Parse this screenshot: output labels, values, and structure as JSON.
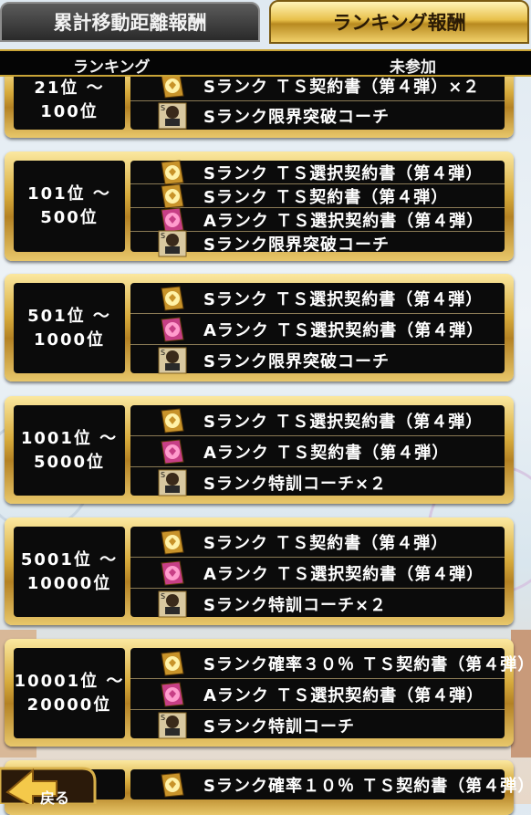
{
  "tabs": [
    {
      "label": "累計移動距離報酬",
      "active": false
    },
    {
      "label": "ランキング報酬",
      "active": true
    }
  ],
  "header": {
    "rank_label": "ランキング",
    "status": "未参加"
  },
  "icons": {
    "s_contract": "gold-contract-icon",
    "a_contract": "pink-contract-icon",
    "coach": "coach-card-icon"
  },
  "rows": [
    {
      "rank": "21位 〜\n100位",
      "rewards": [
        {
          "icon": "s_contract",
          "text": "Sランク ＴＳ契約書（第４弾）×２"
        },
        {
          "icon": "coach",
          "text": "Sランク限界突破コーチ"
        }
      ]
    },
    {
      "rank": "101位 〜\n500位",
      "rewards": [
        {
          "icon": "s_contract",
          "text": "Sランク ＴＳ選択契約書（第４弾）"
        },
        {
          "icon": "s_contract",
          "text": "Sランク ＴＳ契約書（第４弾）"
        },
        {
          "icon": "a_contract",
          "text": "Aランク ＴＳ選択契約書（第４弾）"
        },
        {
          "icon": "coach",
          "text": "Sランク限界突破コーチ"
        }
      ]
    },
    {
      "rank": "501位 〜\n1000位",
      "rewards": [
        {
          "icon": "s_contract",
          "text": "Sランク ＴＳ選択契約書（第４弾）"
        },
        {
          "icon": "a_contract",
          "text": "Aランク ＴＳ選択契約書（第４弾）"
        },
        {
          "icon": "coach",
          "text": "Sランク限界突破コーチ"
        }
      ]
    },
    {
      "rank": "1001位 〜\n5000位",
      "rewards": [
        {
          "icon": "s_contract",
          "text": "Sランク ＴＳ選択契約書（第４弾）"
        },
        {
          "icon": "a_contract",
          "text": "Aランク ＴＳ契約書（第４弾）"
        },
        {
          "icon": "coach",
          "text": "Sランク特訓コーチ×２"
        }
      ]
    },
    {
      "rank": "5001位 〜\n10000位",
      "rewards": [
        {
          "icon": "s_contract",
          "text": "Sランク ＴＳ契約書（第４弾）"
        },
        {
          "icon": "a_contract",
          "text": "Aランク ＴＳ選択契約書（第４弾）"
        },
        {
          "icon": "coach",
          "text": "Sランク特訓コーチ×２"
        }
      ]
    },
    {
      "rank": "10001位 〜\n20000位",
      "rewards": [
        {
          "icon": "s_contract",
          "text": "Sランク確率３０％ ＴＳ契約書（第４弾）"
        },
        {
          "icon": "a_contract",
          "text": "Aランク ＴＳ選択契約書（第４弾）"
        },
        {
          "icon": "coach",
          "text": "Sランク特訓コーチ"
        }
      ]
    },
    {
      "rank": "",
      "rewards": [
        {
          "icon": "s_contract",
          "text": "Sランク確率１０％ ＴＳ契約書（第４弾）"
        }
      ]
    }
  ],
  "back_button": {
    "label": "戻る"
  },
  "colors": {
    "gold": "#d7ab3c",
    "panel": "#0b0b0b",
    "pink": "#e0559a"
  }
}
